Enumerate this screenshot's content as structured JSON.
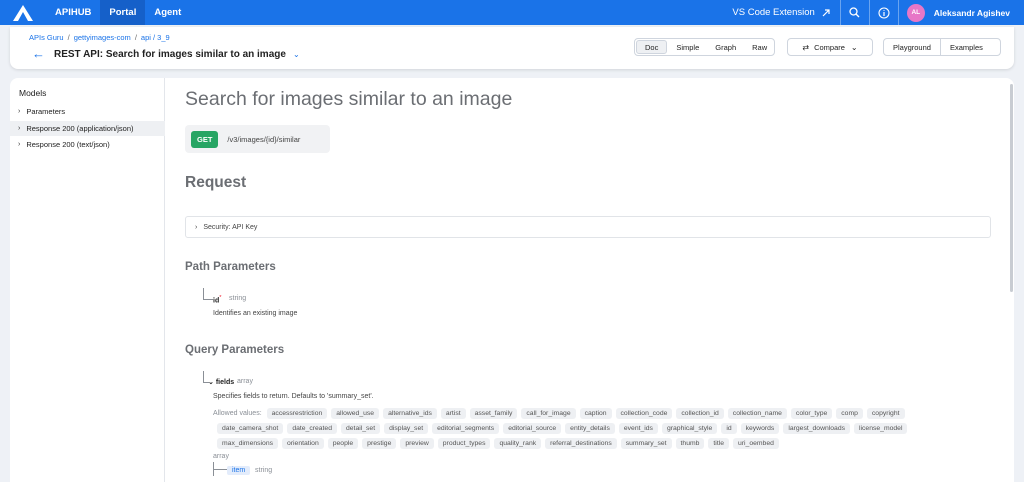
{
  "nav": {
    "items": [
      "APIHUB",
      "Portal",
      "Agent"
    ],
    "active_index": 1,
    "vscode": "VS Code Extension",
    "user_initials": "AL",
    "user_name": "Aleksandr Agishev"
  },
  "breadcrumb": [
    "APIs Guru",
    "gettyimages-com",
    "api / 3_9"
  ],
  "header": {
    "title": "REST API: Search for images similar to an image",
    "views": [
      "Doc",
      "Simple",
      "Graph",
      "Raw"
    ],
    "selected_view": "Doc",
    "compare": "Compare",
    "playground": "Playground",
    "examples": "Examples"
  },
  "sidebar": {
    "title": "Models",
    "items": [
      {
        "label": "Parameters"
      },
      {
        "label": "Response 200 (application/json)"
      },
      {
        "label": "Response 200 (text/json)"
      }
    ],
    "highlighted_index": 1
  },
  "doc": {
    "title": "Search for images similar to an image",
    "method": "GET",
    "path": "/v3/images/{id}/similar",
    "request_heading": "Request",
    "security": "Security: API Key",
    "path_params_heading": "Path Parameters",
    "path_param": {
      "name": "id",
      "required_mark": "*",
      "type": "string",
      "description": "Identifies an existing image"
    },
    "query_params_heading": "Query Parameters",
    "query_param": {
      "name": "fields",
      "type": "array",
      "description": "Specifies fields to return. Defaults to 'summary_set'.",
      "allowed_label": "Allowed values:",
      "allowed_values": [
        "accessrestriction",
        "allowed_use",
        "alternative_ids",
        "artist",
        "asset_family",
        "call_for_image",
        "caption",
        "collection_code",
        "collection_id",
        "collection_name",
        "color_type",
        "comp",
        "copyright",
        "date_camera_shot",
        "date_created",
        "detail_set",
        "display_set",
        "editorial_segments",
        "editorial_source",
        "entity_details",
        "event_ids",
        "graphical_style",
        "id",
        "keywords",
        "largest_downloads",
        "license_model",
        "max_dimensions",
        "orientation",
        "people",
        "prestige",
        "preview",
        "product_types",
        "quality_rank",
        "referral_destinations",
        "summary_set",
        "thumb",
        "title",
        "uri_oembed"
      ],
      "array_label": "array",
      "item_label": "item",
      "item_type": "string"
    }
  },
  "colors": {
    "brand": "#1a73e8",
    "get": "#27a564"
  }
}
